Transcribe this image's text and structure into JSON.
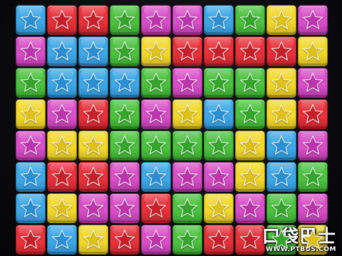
{
  "board": {
    "rows": 8,
    "columns": 10,
    "colors": {
      "blue": {
        "tile": "#3ea8e6",
        "star": "#2b8fd3",
        "edge": "#1a6aa8"
      },
      "red": {
        "tile": "#e8323b",
        "star": "#c8202a",
        "edge": "#8f1218"
      },
      "green": {
        "tile": "#4cc23f",
        "star": "#35a52c",
        "edge": "#247a1c"
      },
      "purple": {
        "tile": "#d84fc8",
        "star": "#bd35ae",
        "edge": "#8a1f7f"
      },
      "yellow": {
        "tile": "#f2d82c",
        "star": "#dfc11a",
        "edge": "#a68d10"
      }
    },
    "grid": [
      [
        "blue",
        "red",
        "red",
        "green",
        "purple",
        "purple",
        "blue",
        "green",
        "yellow",
        "purple"
      ],
      [
        "purple",
        "blue",
        "blue",
        "green",
        "yellow",
        "red",
        "red",
        "red",
        "red",
        "yellow"
      ],
      [
        "green",
        "blue",
        "blue",
        "blue",
        "green",
        "purple",
        "green",
        "green",
        "yellow",
        "purple"
      ],
      [
        "yellow",
        "purple",
        "red",
        "green",
        "purple",
        "yellow",
        "blue",
        "green",
        "yellow",
        "red"
      ],
      [
        "purple",
        "yellow",
        "yellow",
        "green",
        "green",
        "green",
        "green",
        "yellow",
        "blue",
        "purple"
      ],
      [
        "blue",
        "red",
        "red",
        "purple",
        "blue",
        "purple",
        "purple",
        "yellow",
        "blue",
        "green"
      ],
      [
        "blue",
        "yellow",
        "purple",
        "purple",
        "red",
        "green",
        "yellow",
        "purple",
        "green",
        "purple"
      ],
      [
        "red",
        "blue",
        "yellow",
        "red",
        "purple",
        "green",
        "red",
        "red",
        "green",
        "yellow"
      ]
    ]
  },
  "watermark": {
    "logo": "口袋巴士",
    "url": "WWW.PTBUS.COM"
  }
}
